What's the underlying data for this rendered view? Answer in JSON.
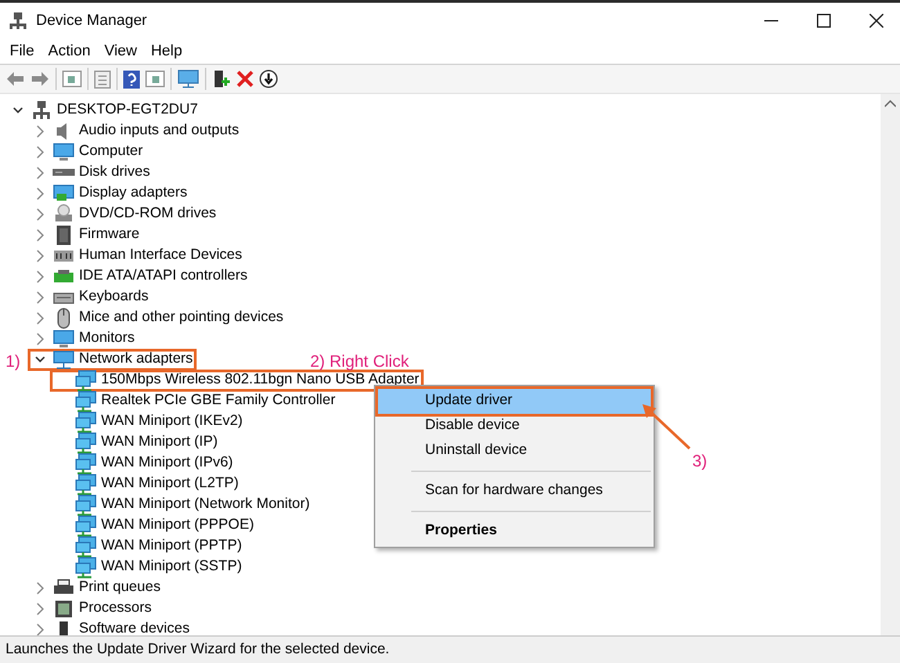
{
  "window": {
    "title": "Device Manager"
  },
  "menu_bar": [
    "File",
    "Action",
    "View",
    "Help"
  ],
  "tree": {
    "label": "DESKTOP-EGT2DU7",
    "expanded": true,
    "boxed": false,
    "children": [
      {
        "label": "Audio inputs and outputs",
        "expanded": false,
        "boxed": false
      },
      {
        "label": "Computer",
        "expanded": false,
        "boxed": false
      },
      {
        "label": "Disk drives",
        "expanded": false,
        "boxed": false
      },
      {
        "label": "Display adapters",
        "expanded": false,
        "boxed": false
      },
      {
        "label": "DVD/CD-ROM drives",
        "expanded": false,
        "boxed": false
      },
      {
        "label": "Firmware",
        "expanded": false,
        "boxed": false
      },
      {
        "label": "Human Interface Devices",
        "expanded": false,
        "boxed": false
      },
      {
        "label": "IDE ATA/ATAPI controllers",
        "expanded": false,
        "boxed": false
      },
      {
        "label": "Keyboards",
        "expanded": false,
        "boxed": false
      },
      {
        "label": "Mice and other pointing devices",
        "expanded": false,
        "boxed": false
      },
      {
        "label": "Monitors",
        "expanded": false,
        "boxed": false
      },
      {
        "label": "Network adapters",
        "expanded": true,
        "boxed": true,
        "children": [
          {
            "label": "150Mbps Wireless 802.11bgn Nano USB Adapter",
            "boxed": true
          },
          {
            "label": "Realtek PCIe GBE Family Controller",
            "boxed": false
          },
          {
            "label": "WAN Miniport (IKEv2)",
            "boxed": false
          },
          {
            "label": "WAN Miniport (IP)",
            "boxed": false
          },
          {
            "label": "WAN Miniport (IPv6)",
            "boxed": false
          },
          {
            "label": "WAN Miniport (L2TP)",
            "boxed": false
          },
          {
            "label": "WAN Miniport (Network Monitor)",
            "boxed": false
          },
          {
            "label": "WAN Miniport (PPPOE)",
            "boxed": false
          },
          {
            "label": "WAN Miniport (PPTP)",
            "boxed": false
          },
          {
            "label": "WAN Miniport (SSTP)",
            "boxed": false
          }
        ]
      },
      {
        "label": "Print queues",
        "expanded": false,
        "boxed": false
      },
      {
        "label": "Processors",
        "expanded": false,
        "boxed": false
      },
      {
        "label": "Software devices",
        "expanded": false,
        "boxed": false
      }
    ]
  },
  "context_menu": [
    {
      "kind": "item",
      "label": "Update driver",
      "selected": true,
      "default": false,
      "boxed": true
    },
    {
      "kind": "item",
      "label": "Disable device",
      "selected": false,
      "default": false,
      "boxed": false
    },
    {
      "kind": "item",
      "label": "Uninstall device",
      "selected": false,
      "default": false,
      "boxed": false
    },
    {
      "kind": "separator"
    },
    {
      "kind": "item",
      "label": "Scan for hardware changes",
      "selected": false,
      "default": false,
      "boxed": false
    },
    {
      "kind": "separator"
    },
    {
      "kind": "item",
      "label": "Properties",
      "selected": false,
      "default": true,
      "boxed": false
    }
  ],
  "annotations": {
    "step_1": "1)",
    "step_2": "2) Right Click",
    "step_3": "3)"
  },
  "status_bar": "Launches the Update Driver Wizard for the selected device."
}
